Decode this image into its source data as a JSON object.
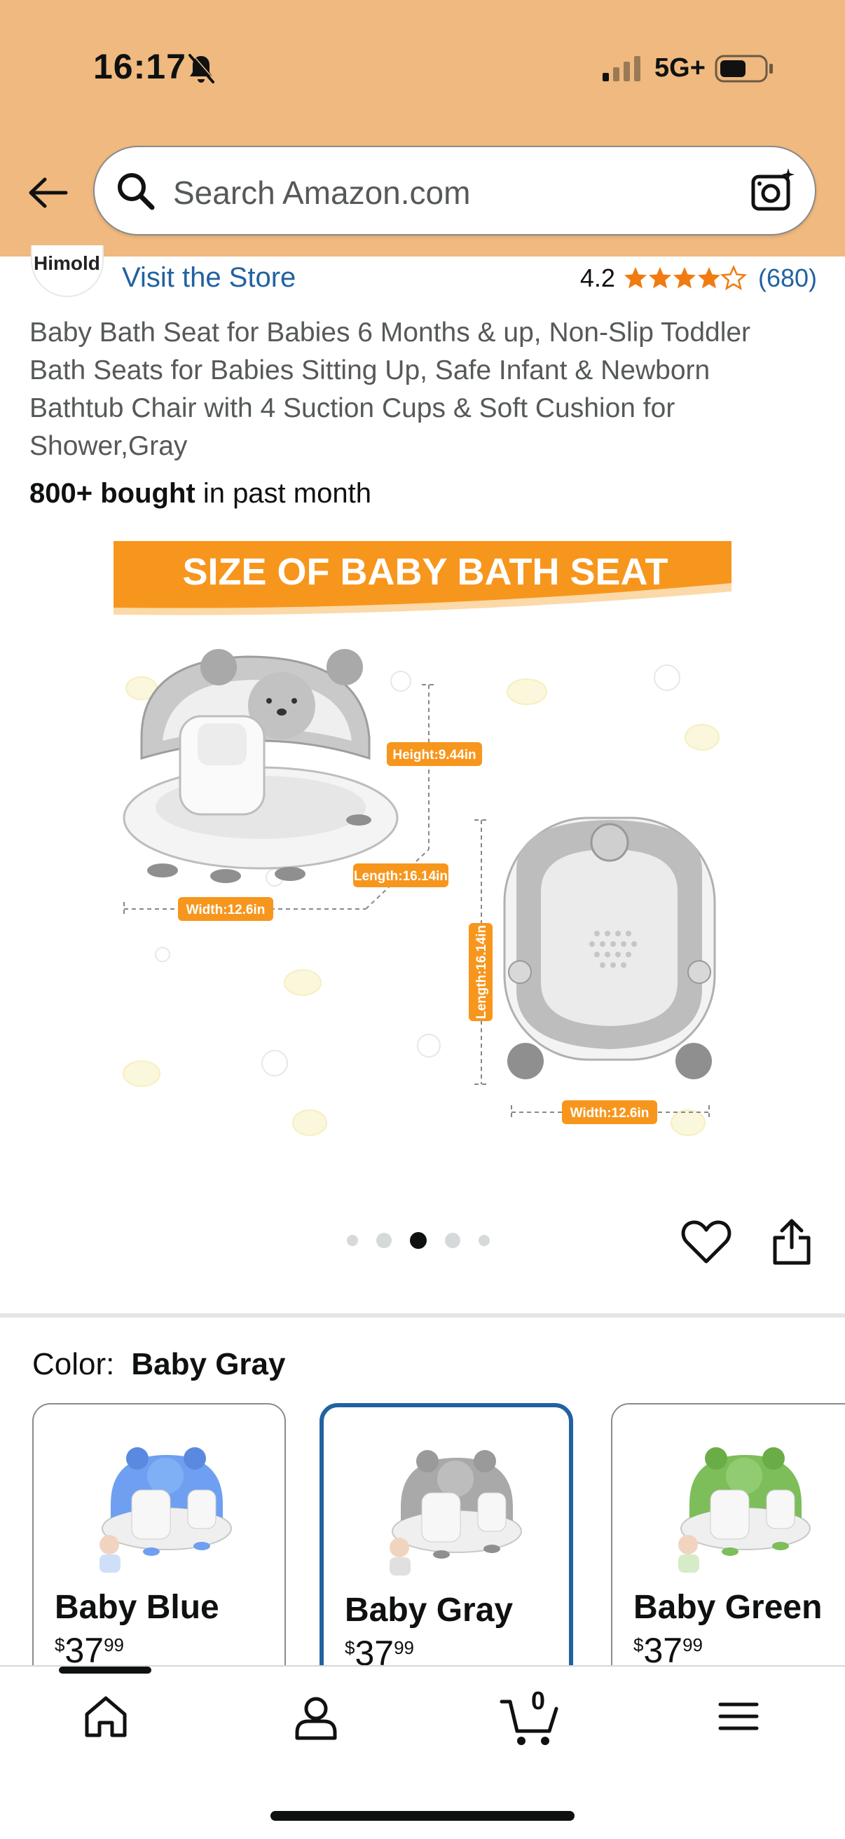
{
  "status_bar": {
    "time": "16:17",
    "network": "5G+"
  },
  "search": {
    "placeholder": "Search Amazon.com"
  },
  "brand": {
    "logo_text": "Himold",
    "store_link": "Visit the Store"
  },
  "rating": {
    "value": "4.2",
    "stars": 4.2,
    "count": "(680)"
  },
  "product": {
    "title": "Baby Bath Seat for Babies 6 Months & up, Non-Slip Toddler Bath Seats for Babies Sitting Up, Safe Infant & Newborn Bathtub Chair with 4 Suction Cups & Soft Cushion for Shower,Gray",
    "bought_bold": "800+ bought",
    "bought_rest": " in past month",
    "image": {
      "banner": "SIZE OF BABY BATH SEAT",
      "height": "Height:9.44in",
      "length_side": "Length:16.14in",
      "width_side": "Width:12.6in",
      "length_top": "Length:16.14in",
      "width_top": "Width:12.6in"
    },
    "carousel": {
      "count": 5,
      "active_index": 2
    }
  },
  "color": {
    "label": "Color:",
    "selected": "Baby Gray",
    "options": [
      {
        "name": "Baby Blue",
        "currency": "$",
        "whole": "37",
        "fraction": "99",
        "color": "#6f9ff0"
      },
      {
        "name": "Baby Gray",
        "currency": "$",
        "whole": "37",
        "fraction": "99",
        "color": "#a9a9a9"
      },
      {
        "name": "Baby Green",
        "currency": "$",
        "whole": "37",
        "fraction": "99",
        "color": "#7dbd5a"
      }
    ]
  },
  "bottom_nav": {
    "cart_count": "0"
  },
  "colors": {
    "header_bg": "#efb97f",
    "link": "#2162a1",
    "star": "#f07b10",
    "banner": "#f7961d",
    "selected_border": "#2162a1"
  }
}
